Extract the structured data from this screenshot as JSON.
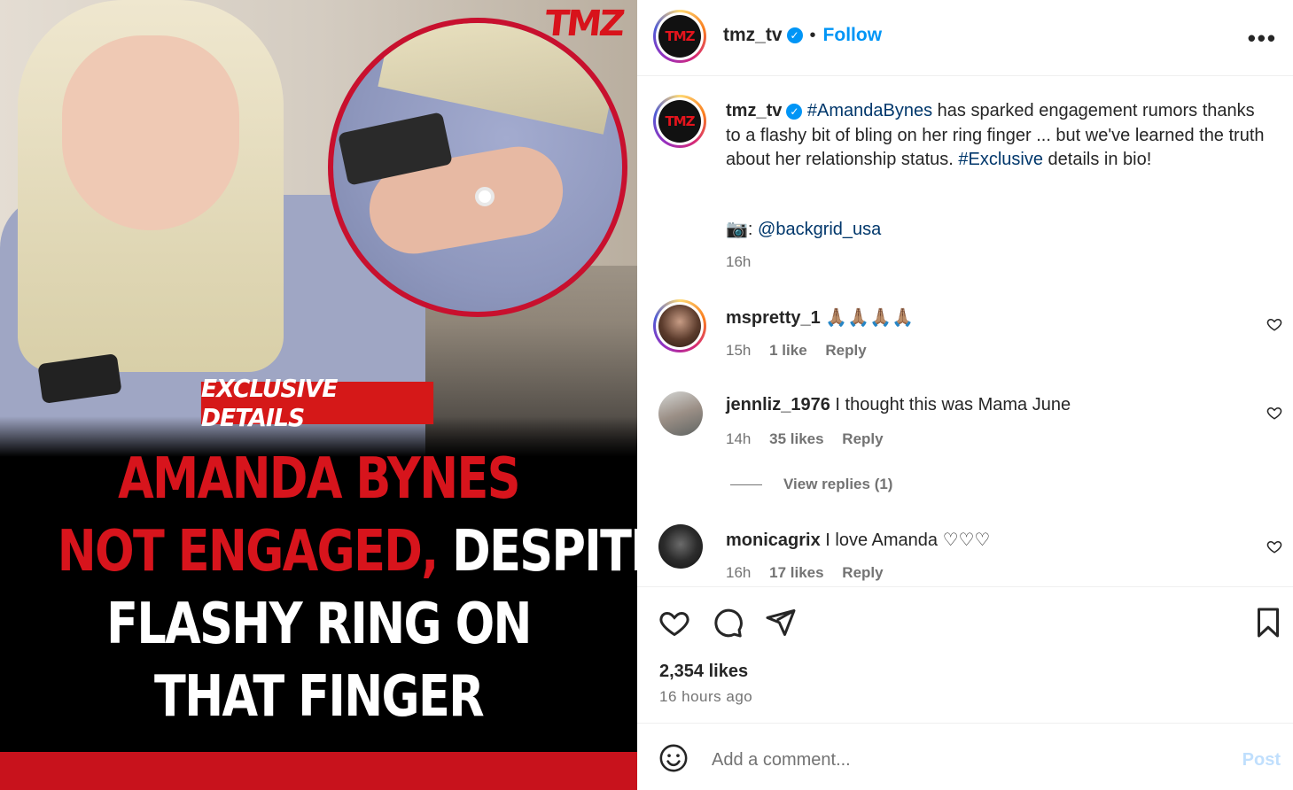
{
  "media": {
    "brand_logo": "TMZ",
    "tag": "EXCLUSIVE DETAILS",
    "headline_lines": [
      {
        "parts": [
          {
            "text": "AMANDA BYNES",
            "color": "red"
          }
        ]
      },
      {
        "parts": [
          {
            "text": "NOT ENGAGED,",
            "color": "red"
          },
          {
            "text": " DESPITE",
            "color": "white"
          }
        ]
      },
      {
        "parts": [
          {
            "text": "FLASHY RING ON",
            "color": "white"
          }
        ]
      },
      {
        "parts": [
          {
            "text": "THAT FINGER",
            "color": "white"
          }
        ]
      }
    ]
  },
  "header": {
    "avatar_text": "TMZ",
    "username": "tmz_tv",
    "follow_label": "Follow",
    "more_icon": "more-horizontal-icon"
  },
  "caption": {
    "username": "tmz_tv",
    "hashtag1": "#AmandaBynes",
    "text1": " has sparked engagement rumors thanks to a flashy bit of bling on her ring finger ... but we've learned the truth about her relationship status. ",
    "hashtag2": "#Exclusive",
    "text2": " details in bio!",
    "credit_emoji": "📷",
    "credit_sep": ": ",
    "credit_handle": "@backgrid_usa",
    "time": "16h"
  },
  "comments": [
    {
      "username": "mspretty_1",
      "text": "🙏🏽🙏🏽🙏🏽🙏🏽",
      "time": "15h",
      "likes": "1 like",
      "reply": "Reply"
    },
    {
      "username": "jennliz_1976",
      "text": "I thought this was Mama June",
      "time": "14h",
      "likes": "35 likes",
      "reply": "Reply"
    },
    {
      "username": "monicagrix",
      "text": "I love Amanda ♡♡♡",
      "time": "16h",
      "likes": "17 likes",
      "reply": "Reply"
    }
  ],
  "view_replies": "View replies (1)",
  "actions": {
    "likes": "2,354 likes",
    "age": "16 hours ago"
  },
  "comment_box": {
    "placeholder": "Add a comment...",
    "post_label": "Post"
  },
  "colors": {
    "accent_blue": "#0095f6",
    "hashtag_blue": "#00376b",
    "brand_red": "#d7141c",
    "muted": "#737373"
  }
}
